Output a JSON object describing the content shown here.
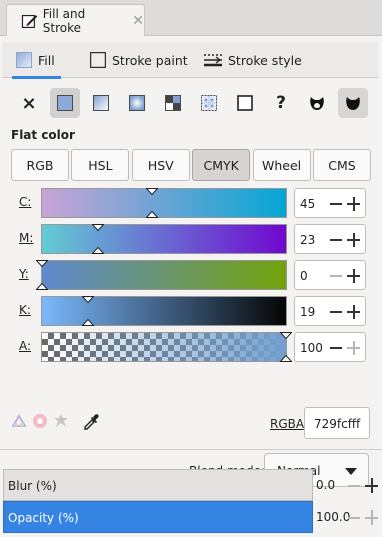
{
  "window": {
    "tab_title": "Fill and Stroke",
    "close_glyph": "✕"
  },
  "mode_tabs": [
    {
      "label": "Fill",
      "icon": "fill-swatch-icon",
      "active": true
    },
    {
      "label": "Stroke paint",
      "icon": "stroke-paint-icon",
      "active": false
    },
    {
      "label": "Stroke style",
      "icon": "stroke-style-icon",
      "active": false
    }
  ],
  "paint_types": [
    {
      "name": "no-paint",
      "glyph": "×"
    },
    {
      "name": "flat-color",
      "active": true
    },
    {
      "name": "linear-gradient"
    },
    {
      "name": "radial-gradient"
    },
    {
      "name": "pattern"
    },
    {
      "name": "mesh"
    },
    {
      "name": "swatch"
    },
    {
      "name": "unset",
      "glyph": "?"
    },
    {
      "name": "fill-rule-evenodd"
    },
    {
      "name": "fill-rule-nonzero",
      "active": true
    }
  ],
  "section_title": "Flat color",
  "color_models": [
    "RGB",
    "HSL",
    "HSV",
    "CMYK",
    "Wheel",
    "CMS"
  ],
  "active_model": "CMYK",
  "sliders": [
    {
      "label": "C:",
      "value": "45",
      "from": "#c9a3d6",
      "to": "#05a6d4",
      "pos": 0.45
    },
    {
      "label": "M:",
      "value": "23",
      "from": "#63cdd4",
      "to": "#7007d0",
      "pos": 0.23
    },
    {
      "label": "Y:",
      "value": "0",
      "from": "#5f88cf",
      "to": "#72a30a",
      "pos": 0.0
    },
    {
      "label": "K:",
      "value": "19",
      "from": "#7ab8fc",
      "to": "#050505",
      "pos": 0.19
    },
    {
      "label": "A:",
      "value": "100",
      "from": "rgba(114,159,207,0)",
      "to": "#729fcf",
      "pos": 1.0
    }
  ],
  "rgba": {
    "label_prefix": "RGBA",
    "label_suffix": ":",
    "value": "729fcfff"
  },
  "blend": {
    "label": "Blend mode:",
    "value": "Normal"
  },
  "blur": {
    "label": "Blur (%)",
    "value": "0.0"
  },
  "opacity": {
    "label": "Opacity (%)",
    "value": "100.0"
  },
  "colors": {
    "accent": "#3584e4",
    "current_color": "#729fcf"
  }
}
